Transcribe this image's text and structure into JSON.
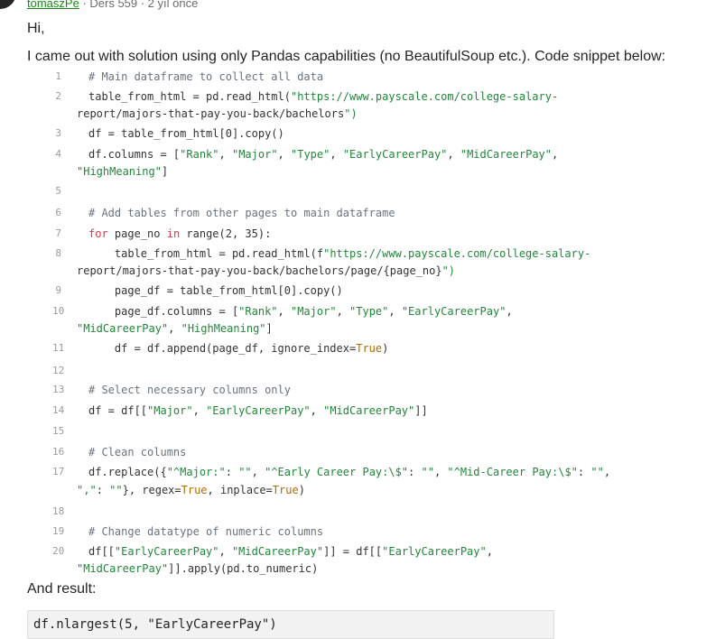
{
  "comment": {
    "author": "tomaszPe",
    "meta_rest": "· Ders 559 · 2 yıl önce",
    "greeting": "Hi,",
    "intro": "I came out with solution using only Pandas capabilities (no BeautifulSoup etc.). Code snippet below:",
    "result_label": "And result:",
    "result_code": "df.nlargest(5, \"EarlyCareerPay\")"
  },
  "code_lines": [
    {
      "n": "1",
      "t": "# Main dataframe to collect all data"
    },
    {
      "n": "2",
      "t": "table_from_html = pd.read_html(\"https://www.payscale.com/college-salary-",
      "c": "report/majors-that-pay-you-back/bachelors\")"
    },
    {
      "n": "3",
      "t": "df = table_from_html[0].copy()"
    },
    {
      "n": "4",
      "t": "df.columns = [\"Rank\", \"Major\", \"Type\", \"EarlyCareerPay\", \"MidCareerPay\",",
      "c": "\"HighMeaning\"]"
    },
    {
      "n": "5",
      "t": ""
    },
    {
      "n": "6",
      "t": "# Add tables from other pages to main dataframe"
    },
    {
      "n": "7",
      "t": "for page_no in range(2, 35):"
    },
    {
      "n": "8",
      "t": "    table_from_html = pd.read_html(f\"https://www.payscale.com/college-salary-",
      "c": "report/majors-that-pay-you-back/bachelors/page/{page_no}\")"
    },
    {
      "n": "9",
      "t": "    page_df = table_from_html[0].copy()"
    },
    {
      "n": "10",
      "t": "    page_df.columns = [\"Rank\", \"Major\", \"Type\", \"EarlyCareerPay\",",
      "c": "\"MidCareerPay\", \"HighMeaning\"]"
    },
    {
      "n": "11",
      "t": "    df = df.append(page_df, ignore_index=True)"
    },
    {
      "n": "12",
      "t": ""
    },
    {
      "n": "13",
      "t": "# Select necessary columns only"
    },
    {
      "n": "14",
      "t": "df = df[[\"Major\", \"EarlyCareerPay\", \"MidCareerPay\"]]"
    },
    {
      "n": "15",
      "t": ""
    },
    {
      "n": "16",
      "t": "# Clean columns"
    },
    {
      "n": "17",
      "t": "df.replace({\"^Major:\": \"\", \"^Early Career Pay:\\$\": \"\", \"^Mid-Career Pay:\\$\": \"\",",
      "c": "\",\": \"\"}, regex=True, inplace=True)"
    },
    {
      "n": "18",
      "t": ""
    },
    {
      "n": "19",
      "t": "# Change datatype of numeric columns"
    },
    {
      "n": "20",
      "t": "df[[\"EarlyCareerPay\", \"MidCareerPay\"]] = df[[\"EarlyCareerPay\",",
      "c": "\"MidCareerPay\"]].apply(pd.to_numeric)"
    }
  ]
}
